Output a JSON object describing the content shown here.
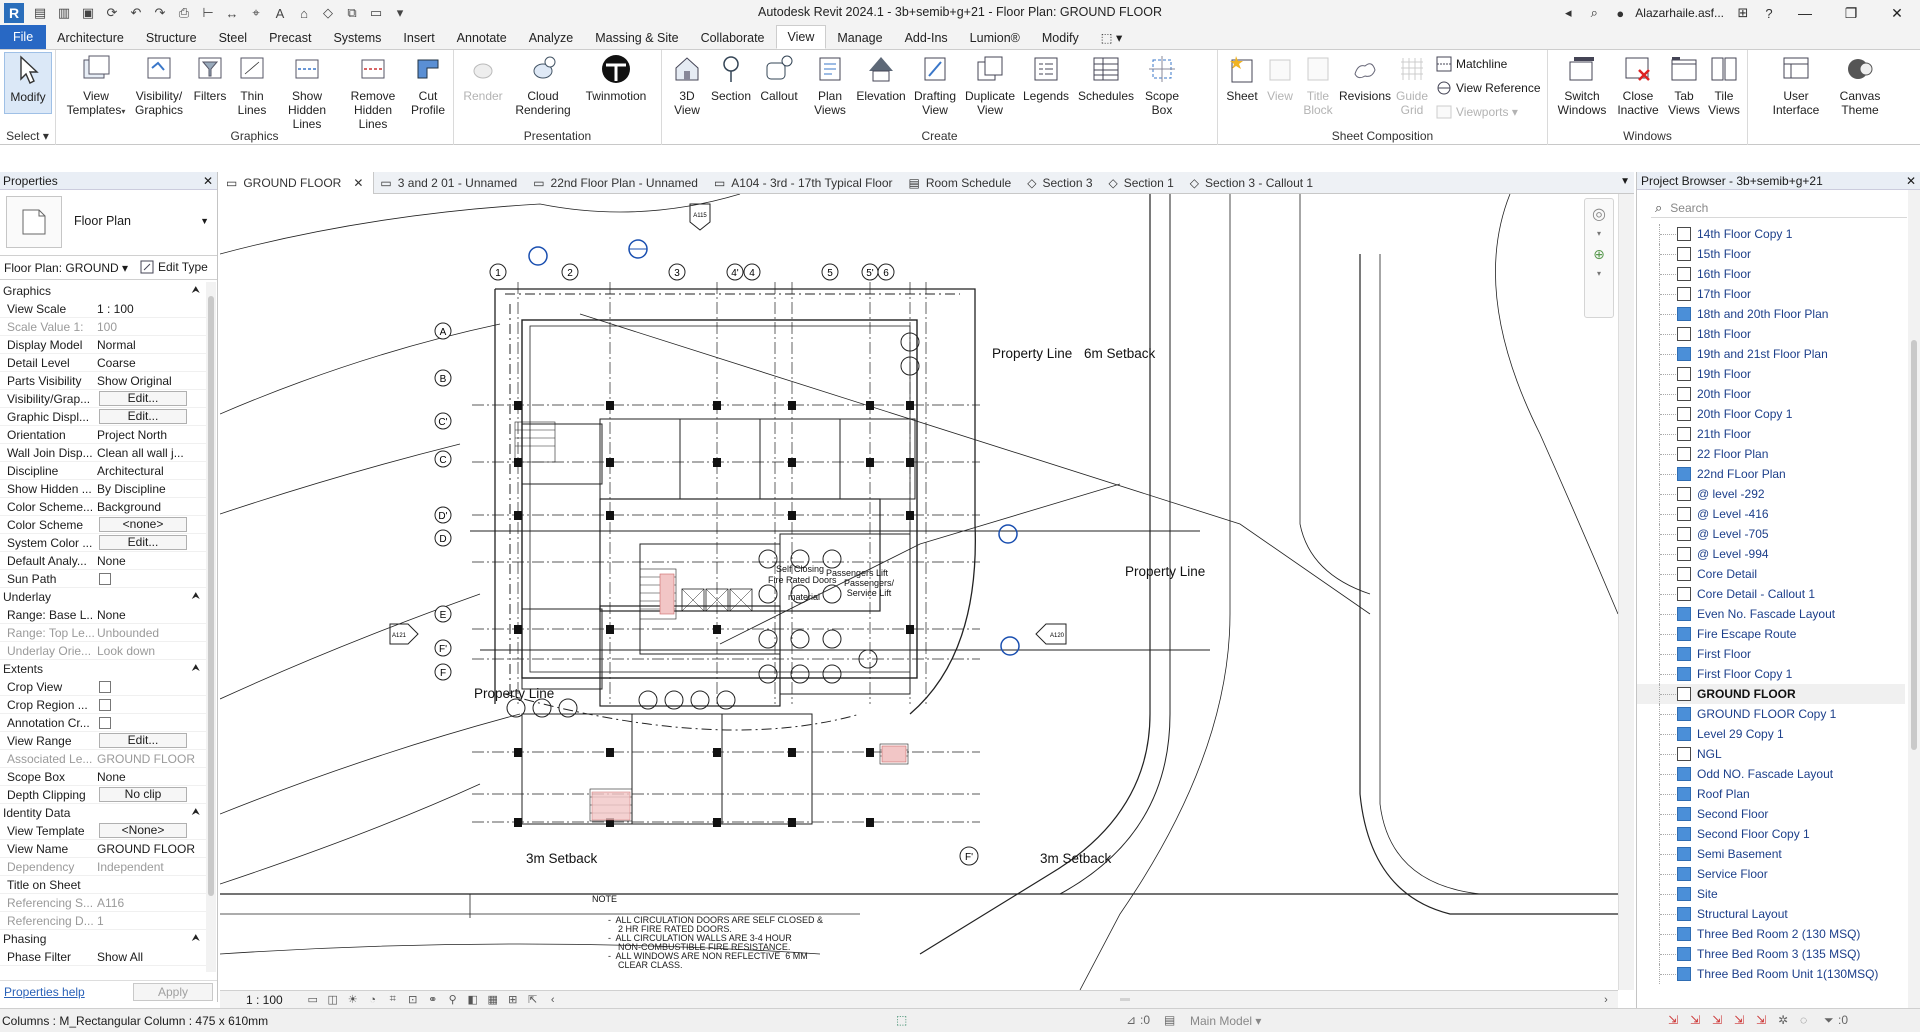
{
  "window": {
    "title": "Autodesk Revit 2024.1 - 3b+semib+g+21 - Floor Plan: GROUND FLOOR",
    "user": "Alazarhaile.asf..."
  },
  "ribbon_tabs": [
    "File",
    "Architecture",
    "Structure",
    "Steel",
    "Precast",
    "Systems",
    "Insert",
    "Annotate",
    "Analyze",
    "Massing & Site",
    "Collaborate",
    "View",
    "Manage",
    "Add-Ins",
    "Lumion®",
    "Modify"
  ],
  "ribbon": {
    "select": {
      "modify": "Modify",
      "title": "Select"
    },
    "graphics": {
      "title": "Graphics",
      "view_templates": "View Templates",
      "visibility_graphics": "Visibility/ Graphics",
      "filters": "Filters",
      "thin_lines": "Thin Lines",
      "show_hidden_lines": "Show Hidden Lines",
      "remove_hidden_lines": "Remove Hidden Lines",
      "cut_profile": "Cut Profile"
    },
    "presentation": {
      "title": "Presentation",
      "render": "Render",
      "cloud_rendering": "Cloud Rendering",
      "twinmotion": "Twinmotion"
    },
    "create": {
      "title": "Create",
      "view_3d": "3D View",
      "section": "Section",
      "callout": "Callout",
      "plan_views": "Plan Views",
      "elevation": "Elevation",
      "drafting_view": "Drafting View",
      "duplicate_view": "Duplicate View",
      "legends": "Legends",
      "schedules": "Schedules",
      "scope_box": "Scope Box"
    },
    "sheet_composition": {
      "title": "Sheet Composition",
      "sheet": "Sheet",
      "view": "View",
      "title_block": "Title Block",
      "revisions": "Revisions",
      "guide_grid": "Guide Grid",
      "matchline": "Matchline",
      "view_reference": "View Reference",
      "viewports": "Viewports"
    },
    "windows": {
      "title": "Windows",
      "switch_windows": "Switch Windows",
      "close_inactive": "Close Inactive",
      "tab_views": "Tab Views",
      "tile_views": "Tile Views",
      "user_interface": "User Interface",
      "canvas_theme": "Canvas Theme"
    }
  },
  "properties": {
    "title": "Properties",
    "type_name": "Floor Plan",
    "instance": "Floor Plan: GROUND",
    "edit_type": "Edit Type",
    "sections": {
      "graphics": "Graphics",
      "underlay": "Underlay",
      "extents": "Extents",
      "identity": "Identity Data",
      "phasing": "Phasing"
    },
    "graphics_rows": [
      {
        "k": "View Scale",
        "v": "1 : 100"
      },
      {
        "k": "Scale Value    1:",
        "v": "100",
        "dim": true
      },
      {
        "k": "Display Model",
        "v": "Normal"
      },
      {
        "k": "Detail Level",
        "v": "Coarse"
      },
      {
        "k": "Parts Visibility",
        "v": "Show Original"
      },
      {
        "k": "Visibility/Grap...",
        "v": "Edit...",
        "btn": true
      },
      {
        "k": "Graphic Displ...",
        "v": "Edit...",
        "btn": true
      },
      {
        "k": "Orientation",
        "v": "Project North"
      },
      {
        "k": "Wall Join Disp...",
        "v": "Clean all wall j..."
      },
      {
        "k": "Discipline",
        "v": "Architectural"
      },
      {
        "k": "Show Hidden ...",
        "v": "By Discipline"
      },
      {
        "k": "Color Scheme...",
        "v": "Background"
      },
      {
        "k": "Color Scheme",
        "v": "<none>",
        "btn": true
      },
      {
        "k": "System Color ...",
        "v": "Edit...",
        "btn": true
      },
      {
        "k": "Default Analy...",
        "v": "None"
      },
      {
        "k": "Sun Path",
        "v": "",
        "chk": true
      }
    ],
    "underlay_rows": [
      {
        "k": "Range: Base L...",
        "v": "None"
      },
      {
        "k": "Range: Top Le...",
        "v": "Unbounded",
        "dim": true
      },
      {
        "k": "Underlay Orie...",
        "v": "Look down",
        "dim": true
      }
    ],
    "extents_rows": [
      {
        "k": "Crop View",
        "v": "",
        "chk": true
      },
      {
        "k": "Crop Region ...",
        "v": "",
        "chk": true
      },
      {
        "k": "Annotation Cr...",
        "v": "",
        "chk": true
      },
      {
        "k": "View Range",
        "v": "Edit...",
        "btn": true
      },
      {
        "k": "Associated Le...",
        "v": "GROUND FLOOR",
        "dim": true
      },
      {
        "k": "Scope Box",
        "v": "None"
      },
      {
        "k": "Depth Clipping",
        "v": "No clip",
        "btn": true
      }
    ],
    "identity_rows": [
      {
        "k": "View Template",
        "v": "<None>",
        "btn": true
      },
      {
        "k": "View Name",
        "v": "GROUND FLOOR"
      },
      {
        "k": "Dependency",
        "v": "Independent",
        "dim": true
      },
      {
        "k": "Title on Sheet",
        "v": ""
      },
      {
        "k": "Referencing S...",
        "v": "A116",
        "dim": true
      },
      {
        "k": "Referencing D...",
        "v": "1",
        "dim": true
      }
    ],
    "phasing_rows": [
      {
        "k": "Phase Filter",
        "v": "Show All"
      }
    ],
    "help": "Properties help",
    "apply": "Apply"
  },
  "view_tabs": [
    {
      "label": "GROUND FLOOR",
      "active": true,
      "icon": "floor-plan-icon"
    },
    {
      "label": "3 and  2 01 - Unnamed",
      "icon": "floor-plan-icon"
    },
    {
      "label": "22nd Floor Plan - Unnamed",
      "icon": "floor-plan-icon"
    },
    {
      "label": "A104 - 3rd - 17th Typical Floor",
      "icon": "floor-plan-icon"
    },
    {
      "label": "Room Schedule",
      "icon": "schedule-icon"
    },
    {
      "label": "Section 3",
      "icon": "section-icon"
    },
    {
      "label": "Section 1",
      "icon": "section-icon"
    },
    {
      "label": "Section 3 - Callout 1",
      "icon": "section-icon"
    }
  ],
  "drawing": {
    "labels": {
      "property_line_top": "Property Line",
      "setback_top": "6m Setback",
      "property_line_right": "Property Line",
      "property_line_left": "Property Line",
      "setback_bottom_left": "3m Setback",
      "setback_bottom_right": "3m Setback",
      "self_closing": "Self Closing",
      "fire_rated": "Fire Rated Doors",
      "material": "material",
      "passengers_lift": "Passengers Lift",
      "passengers_service": "Passengers/ Service Lift",
      "note_title": "NOTE"
    },
    "note_lines": [
      "-  ALL CIRCULATION DOORS ARE SELF CLOSED &",
      "    2 HR FIRE RATED DOORS.",
      "-  ALL CIRCULATION WALLS ARE 3-4 HOUR",
      "    NON-COMBUSTIBLE FIRE RESISTANCE.",
      "-  ALL WINDOWS ARE NON REFLECTIVE  6 MM",
      "    CLEAR CLASS."
    ],
    "grid_cols": [
      "1",
      "2",
      "3",
      "4'",
      "4",
      "5",
      "5'",
      "6"
    ],
    "grid_rows": [
      "A",
      "B",
      "C'",
      "C",
      "D'",
      "D",
      "E",
      "F'",
      "F"
    ],
    "grid_right": "F'",
    "elevation_tags": {
      "top": "A115",
      "left": "A121",
      "right": "A120"
    }
  },
  "view_control": {
    "scale": "1 : 100"
  },
  "browser": {
    "title": "Project Browser - 3b+semib+g+21",
    "search_placeholder": "Search",
    "items": [
      {
        "label": "14th Floor Copy 1",
        "blue": false
      },
      {
        "label": "15th Floor",
        "blue": false
      },
      {
        "label": "16th Floor",
        "blue": false
      },
      {
        "label": "17th Floor",
        "blue": false
      },
      {
        "label": "18th and 20th Floor Plan",
        "blue": true
      },
      {
        "label": "18th Floor",
        "blue": false
      },
      {
        "label": "19th and 21st Floor Plan",
        "blue": true
      },
      {
        "label": "19th Floor",
        "blue": false
      },
      {
        "label": "20th Floor",
        "blue": false
      },
      {
        "label": "20th Floor Copy 1",
        "blue": false
      },
      {
        "label": "21th Floor",
        "blue": false
      },
      {
        "label": "22 Floor Plan",
        "blue": false
      },
      {
        "label": "22nd FLoor Plan",
        "blue": true
      },
      {
        "label": "@ level -292",
        "blue": false
      },
      {
        "label": "@ Level -416",
        "blue": false
      },
      {
        "label": "@ Level -705",
        "blue": false
      },
      {
        "label": "@ Level -994",
        "blue": false
      },
      {
        "label": "Core Detail",
        "blue": false
      },
      {
        "label": "Core Detail - Callout 1",
        "blue": false
      },
      {
        "label": "Even No. Fascade Layout",
        "blue": true
      },
      {
        "label": "Fire Escape Route",
        "blue": true
      },
      {
        "label": "First Floor",
        "blue": true
      },
      {
        "label": "First Floor Copy 1",
        "blue": true
      },
      {
        "label": "GROUND FLOOR",
        "blue": false,
        "selected": true
      },
      {
        "label": "GROUND FLOOR Copy 1",
        "blue": true
      },
      {
        "label": "Level 29 Copy 1",
        "blue": true
      },
      {
        "label": "NGL",
        "blue": false
      },
      {
        "label": "Odd NO. Fascade Layout",
        "blue": true
      },
      {
        "label": "Roof Plan",
        "blue": true
      },
      {
        "label": "Second Floor",
        "blue": true
      },
      {
        "label": "Second Floor Copy 1",
        "blue": true
      },
      {
        "label": "Semi Basement",
        "blue": true
      },
      {
        "label": "Service Floor",
        "blue": true
      },
      {
        "label": "Site",
        "blue": true
      },
      {
        "label": "Structural Layout",
        "blue": true
      },
      {
        "label": "Three Bed Room 2 (130 MSQ)",
        "blue": true
      },
      {
        "label": "Three Bed Room 3 (135 MSQ)",
        "blue": true
      },
      {
        "label": "Three Bed Room Unit 1(130MSQ)",
        "blue": true
      }
    ]
  },
  "status": {
    "text": "Columns : M_Rectangular Column : 475 x 610mm",
    "worksets": ":0",
    "model": "Main Model",
    "filter_count": ":0"
  }
}
